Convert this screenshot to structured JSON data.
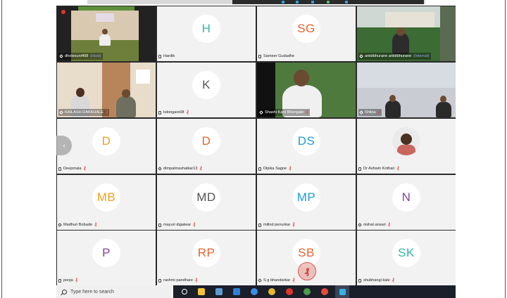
{
  "window": {
    "app": "Zoom Meeting - Gallery View"
  },
  "participants": [
    {
      "id": "p1",
      "name": "dholesuni408",
      "tag": "(Host)",
      "type": "video",
      "scene": "yoga",
      "muted": false
    },
    {
      "id": "p2",
      "name": "Hardik",
      "initials": "H",
      "color": "#2fb7a8",
      "type": "avatar",
      "muted": false
    },
    {
      "id": "p3",
      "name": "Sameer Gudadhe",
      "initials": "SG",
      "color": "#e8622c",
      "type": "avatar",
      "muted": false
    },
    {
      "id": "p4",
      "name": "ankitbhurane ankitbhurane",
      "tag": "(Internal)",
      "type": "video",
      "scene": "garden",
      "muted": false
    },
    {
      "id": "p5",
      "name": "KAILASH DAKKHALE",
      "type": "video",
      "scene": "room",
      "muted": true
    },
    {
      "id": "p6",
      "name": "kdongare08",
      "initials": "K",
      "color": "#555555",
      "type": "avatar",
      "muted": true
    },
    {
      "id": "p7",
      "name": "Shashi Kant Bhongale",
      "type": "video",
      "scene": "outdoor",
      "muted": true
    },
    {
      "id": "p8",
      "name": "Shilpa",
      "type": "video",
      "scene": "hall",
      "muted": true
    },
    {
      "id": "p9",
      "name": "Deepmala",
      "initials": "D",
      "color": "#f0a020",
      "type": "avatar",
      "muted": true
    },
    {
      "id": "p10",
      "name": "dimpalmashalkar13",
      "initials": "D",
      "color": "#e8622c",
      "type": "avatar",
      "muted": true
    },
    {
      "id": "p11",
      "name": "Dipika Sagne",
      "initials": "DS",
      "color": "#1f9ad6",
      "type": "avatar",
      "muted": true
    },
    {
      "id": "p12",
      "name": "Dr Ashwin Kothari",
      "type": "photo",
      "muted": true
    },
    {
      "id": "p13",
      "name": "Madhuri Bobade",
      "initials": "MB",
      "color": "#f0a020",
      "type": "avatar",
      "muted": true
    },
    {
      "id": "p14",
      "name": "mayuri digalwar",
      "initials": "MD",
      "color": "#555555",
      "type": "avatar",
      "muted": true
    },
    {
      "id": "p15",
      "name": "milind penurkar",
      "initials": "MP",
      "color": "#1f9ad6",
      "type": "avatar",
      "muted": true
    },
    {
      "id": "p16",
      "name": "nishat.ansari",
      "initials": "N",
      "color": "#8a3ea0",
      "type": "avatar",
      "muted": true
    },
    {
      "id": "p17",
      "name": "pooja",
      "initials": "P",
      "color": "#8a3ea0",
      "type": "avatar",
      "muted": true
    },
    {
      "id": "p18",
      "name": "rashmi pandhare",
      "initials": "RP",
      "color": "#e8622c",
      "type": "avatar",
      "muted": true
    },
    {
      "id": "p19",
      "name": "S g bhandarkar",
      "initials": "SB",
      "color": "#e8622c",
      "type": "avatar",
      "muted": true
    },
    {
      "id": "p20",
      "name": "shubhangi kale",
      "initials": "SK",
      "color": "#2fb7a8",
      "type": "avatar",
      "muted": true
    }
  ],
  "taskbar": {
    "search_placeholder": "Type here to search",
    "app_icons": [
      "cortana-icon",
      "task-view-icon",
      "file-explorer-icon",
      "store-icon",
      "edge-icon",
      "chrome-icon",
      "opera-icon",
      "chrome2-icon",
      "zoom-icon"
    ]
  },
  "icons": {
    "muted_mic": "₰",
    "prev_page": "‹"
  },
  "colors": {
    "active_speaker": "#3fd67c",
    "muted": "#d9534f",
    "taskbar": "#1b1f2a",
    "tile": "#f2f2f2"
  }
}
